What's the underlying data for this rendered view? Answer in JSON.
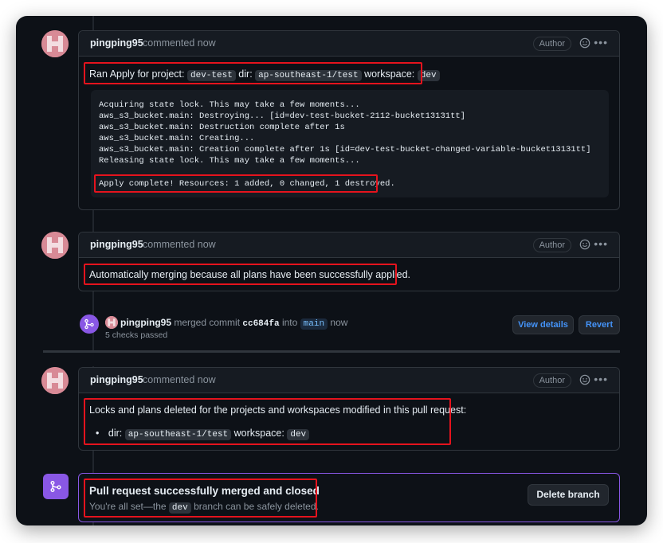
{
  "comments": [
    {
      "author": "pingping95",
      "time": "commented now",
      "badge": "Author",
      "intro_prefix": "Ran Apply for project:",
      "project": "dev-test",
      "dir_label": "dir:",
      "dir": "ap-southeast-1/test",
      "workspace_label": "workspace:",
      "workspace": "dev",
      "output_lines": [
        "Acquiring state lock. This may take a few moments...",
        "aws_s3_bucket.main: Destroying... [id=dev-test-bucket-2112-bucket13131tt]",
        "aws_s3_bucket.main: Destruction complete after 1s",
        "aws_s3_bucket.main: Creating...",
        "aws_s3_bucket.main: Creation complete after 1s [id=dev-test-bucket-changed-variable-bucket13131tt]",
        "Releasing state lock. This may take a few moments..."
      ],
      "summary_line": "Apply complete! Resources: 1 added, 0 changed, 1 destroyed."
    },
    {
      "author": "pingping95",
      "time": "commented now",
      "badge": "Author",
      "text": "Automatically merging because all plans have been successfully applied."
    },
    {
      "author": "pingping95",
      "time": "commented now",
      "badge": "Author",
      "text": "Locks and plans deleted for the projects and workspaces modified in this pull request:",
      "bullet_dir_label": "dir:",
      "bullet_dir": "ap-southeast-1/test",
      "bullet_workspace_label": "workspace:",
      "bullet_workspace": "dev"
    }
  ],
  "merge_event": {
    "author": "pingping95",
    "merged_commit_label": "merged commit",
    "commit": "cc684fa",
    "into_label": "into",
    "branch": "main",
    "time": "now",
    "checks": "5 checks passed",
    "view_details": "View details",
    "revert": "Revert"
  },
  "merged_banner": {
    "title": "Pull request successfully merged and closed",
    "subtitle_prefix": "You're all set—the",
    "branch": "dev",
    "subtitle_suffix": "branch can be safely deleted.",
    "delete_button": "Delete branch"
  },
  "colors": {
    "background": "#0d1117",
    "merged_purple": "#8957e5",
    "highlight_red": "#e5131d",
    "link_blue": "#4493f8"
  }
}
